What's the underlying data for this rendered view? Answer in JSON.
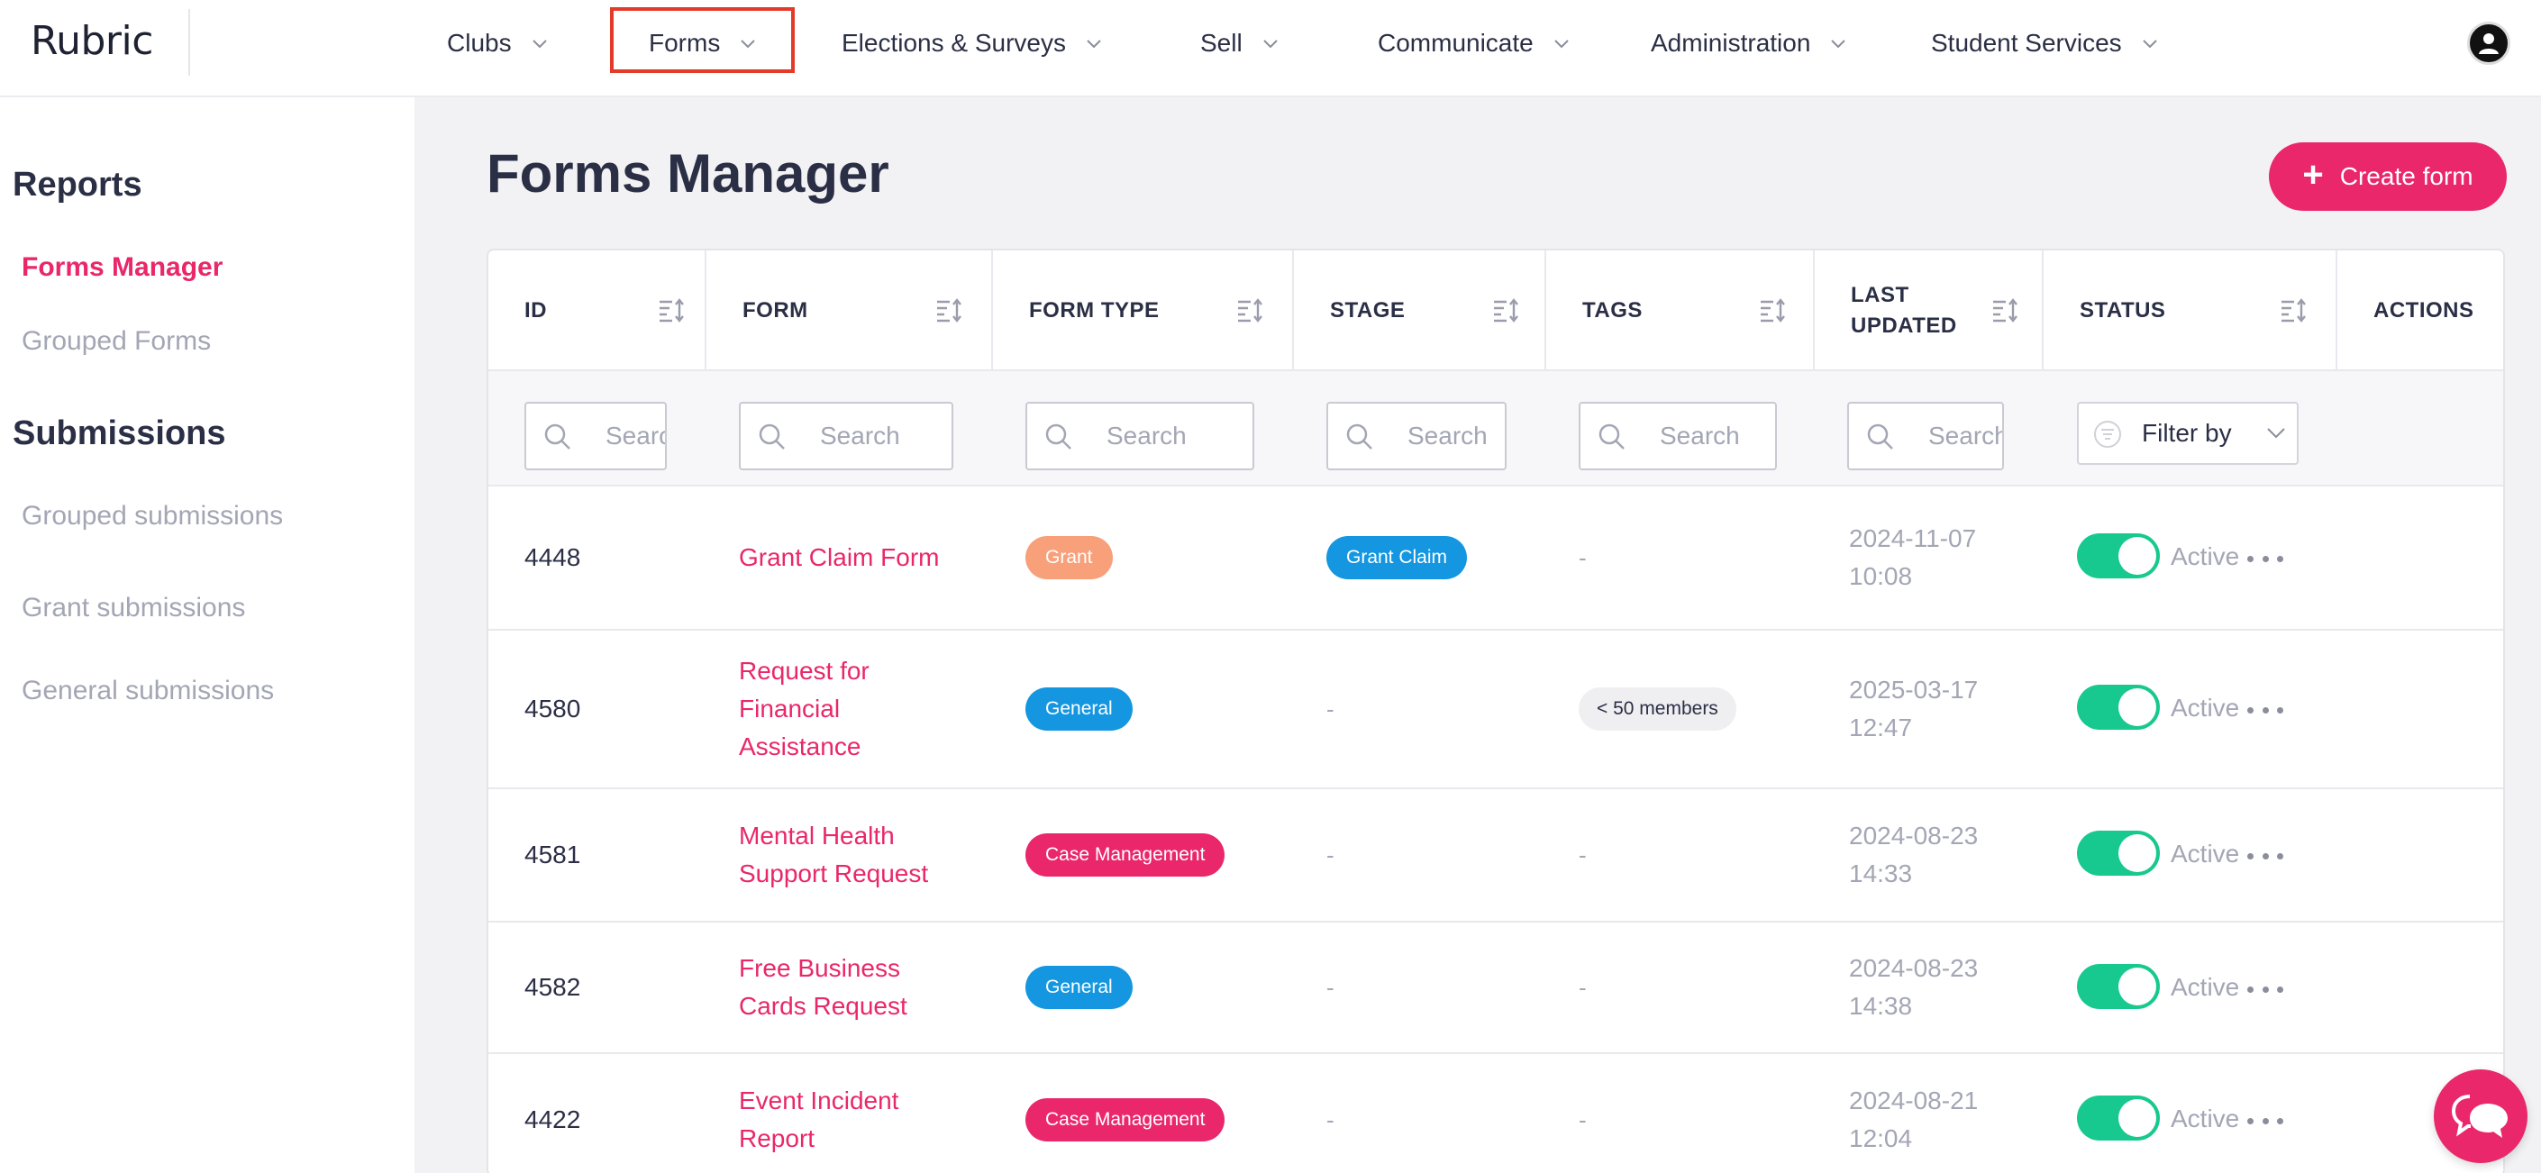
{
  "app": {
    "logo": "Rubric"
  },
  "nav": {
    "items": [
      {
        "label": "Clubs"
      },
      {
        "label": "Forms"
      },
      {
        "label": "Elections & Surveys"
      },
      {
        "label": "Sell"
      },
      {
        "label": "Communicate"
      },
      {
        "label": "Administration"
      },
      {
        "label": "Student Services"
      }
    ],
    "highlighted": "Forms"
  },
  "sidebar": {
    "sections": [
      {
        "heading": "Reports",
        "items": [
          {
            "label": "Forms Manager",
            "active": true
          },
          {
            "label": "Grouped Forms",
            "active": false
          }
        ]
      },
      {
        "heading": "Submissions",
        "items": [
          {
            "label": "Grouped submissions"
          },
          {
            "label": "Grant submissions"
          },
          {
            "label": "General submissions"
          }
        ]
      }
    ]
  },
  "main": {
    "title": "Forms Manager",
    "create_button": "Create form"
  },
  "table": {
    "columns": [
      "ID",
      "FORM",
      "FORM TYPE",
      "STAGE",
      "TAGS",
      "LAST UPDATED",
      "STATUS",
      "ACTIONS"
    ],
    "search_placeholder": "Search",
    "filter_label": "Filter by",
    "rows": [
      {
        "id": "4448",
        "form": "Grant Claim Form",
        "form_type": "Grant",
        "stage": "Grant Claim",
        "tags": "-",
        "updated_date": "2024-11-07",
        "updated_time": "10:08",
        "status": "Active"
      },
      {
        "id": "4580",
        "form": "Request for Financial Assistance",
        "form_type": "General",
        "stage": "-",
        "tags": "< 50 members",
        "updated_date": "2025-03-17",
        "updated_time": "12:47",
        "status": "Active"
      },
      {
        "id": "4581",
        "form": "Mental Health Support Request",
        "form_type": "Case Management",
        "stage": "-",
        "tags": "-",
        "updated_date": "2024-08-23",
        "updated_time": "14:33",
        "status": "Active"
      },
      {
        "id": "4582",
        "form": "Free Business Cards Request",
        "form_type": "General",
        "stage": "-",
        "tags": "-",
        "updated_date": "2024-08-23",
        "updated_time": "14:38",
        "status": "Active"
      },
      {
        "id": "4422",
        "form": "Event Incident Report",
        "form_type": "Case Management",
        "stage": "-",
        "tags": "-",
        "updated_date": "2024-08-21",
        "updated_time": "12:04",
        "status": "Active"
      }
    ]
  },
  "colors": {
    "accent": "#e9276a",
    "toggle_on": "#18c98f",
    "blue_badge": "#1496e0",
    "grant_badge": "#f8a07a",
    "highlight": "#e33a2a"
  }
}
